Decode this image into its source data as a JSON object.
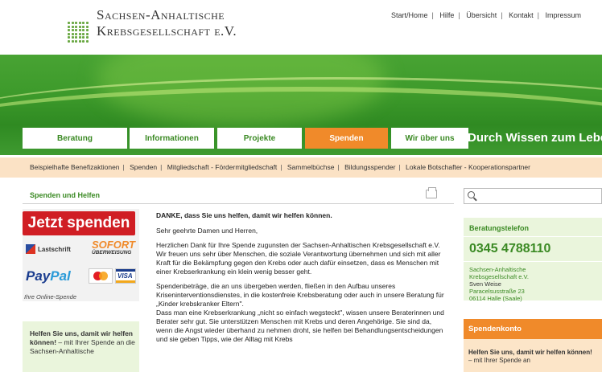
{
  "header": {
    "logo_line1": "Sachsen-Anhaltische",
    "logo_line2": "Krebsgesellschaft e.V.",
    "topnav": [
      "Start/Home",
      "Hilfe",
      "Übersicht",
      "Kontakt",
      "Impressum"
    ]
  },
  "mainnav": {
    "tabs": [
      {
        "label": "Beratung",
        "active": false
      },
      {
        "label": "Informationen",
        "active": false
      },
      {
        "label": "Projekte",
        "active": false
      },
      {
        "label": "Spenden",
        "active": true
      },
      {
        "label": "Wir über uns",
        "active": false
      }
    ],
    "slogan": "Durch Wissen zum Leben"
  },
  "subnav": [
    "Beispielhafte Benefizaktionen",
    "Spenden",
    "Mitgliedschaft - Fördermitgliedschaft",
    "Sammelbüchse",
    "Bildungsspender",
    "Lokale Botschafter - Kooperationspartner"
  ],
  "section": {
    "title": "Spenden und Helfen"
  },
  "donate": {
    "button_label": "Jetzt spenden",
    "lastschrift": "Lastschrift",
    "sofort_top": "SOFORT",
    "sofort_bottom": "ÜBERWEISUNG",
    "paypal_a": "Pay",
    "paypal_b": "Pal",
    "visa": "VISA",
    "caption": "Ihre Online-Spende"
  },
  "helfen_box": {
    "bold": "Helfen Sie uns, damit wir helfen können!",
    "text": " – mit Ihrer Spende an die Sachsen-Anhaltische"
  },
  "content": {
    "heading": "DANKE, dass Sie uns helfen, damit wir helfen können.",
    "greeting": "Sehr geehrte Damen und Herren,",
    "p1": "Herzlichen Dank für Ihre Spende zugunsten der Sachsen-Anhaltischen Krebsgesellschaft e.V.\nWir freuen uns sehr über Menschen, die soziale Verantwortung übernehmen und sich mit aller Kraft für die Bekämpfung gegen den Krebs oder auch dafür einsetzen, dass es Menschen mit einer Krebserkrankung ein klein wenig besser geht.",
    "p2": "Spendenbeträge, die an uns übergeben werden, fließen in den Aufbau unseres Kriseninterventionsdienstes, in die kostenfreie Krebsberatung oder auch in unsere Beratung für „Kinder krebskranker Eltern\".\nDass man eine Krebserkrankung „nicht so einfach wegsteckt\", wissen unsere Beraterinnen und Berater sehr gut. Sie unterstützen Menschen mit Krebs und deren Angehörige. Sie sind da, wenn die Angst wieder überhand zu nehmen droht, sie helfen bei Behandlungsentscheidungen und sie geben Tipps, wie der Alltag mit Krebs"
  },
  "sidebar": {
    "search_placeholder": "",
    "phone_title": "Beratungstelefon",
    "phone_number": "0345 4788110",
    "address": [
      "Sachsen-Anhaltische",
      "Krebsgesellschaft e.V.",
      "Sven Weise",
      "Paracelsusstraße 23",
      "06114 Halle (Saale)"
    ],
    "konto_title": "Spendenkonto",
    "konto_bold": "Helfen Sie uns, damit wir helfen können!",
    "konto_text": " – mit Ihrer Spende an"
  },
  "colors": {
    "green": "#3b8a24",
    "orange": "#f08a2a",
    "red": "#d01e24"
  }
}
